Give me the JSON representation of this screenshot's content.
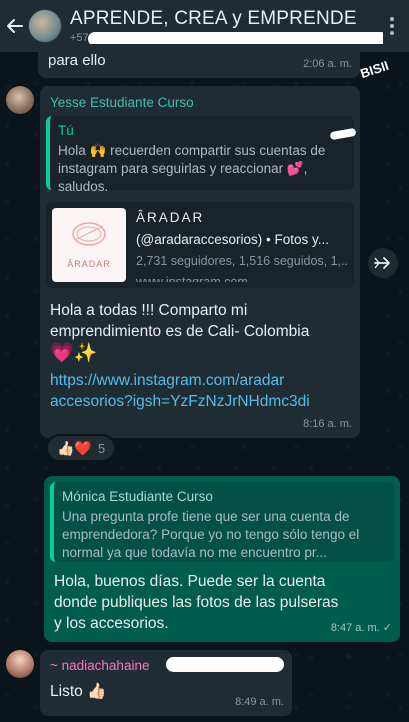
{
  "header": {
    "title": "APRENDE, CREA y EMPRENDE",
    "subtitle": "+57 ... 205...",
    "back_icon": "arrow-left-icon",
    "menu_icon": "vertical-dots-icon"
  },
  "top_message": {
    "text": "para ello",
    "time": "2:06 a. m."
  },
  "message_yesse": {
    "sender": "Yesse Estudiante Curso",
    "quote_author": "Tú",
    "quote_text": "Hola 🙌 recuerden compartir sus cuentas de instagram para seguirlas y reaccionar 💕, saludos.",
    "link_card": {
      "thumb_brand": "ÂRADAR",
      "title": "ÂRADAR",
      "subtitle": "(@aradaraccesorios) • Fotos y...",
      "description": "2,731 seguidores, 1,516 seguidos, 1,... ",
      "domain": "www.instagram.com"
    },
    "body_line1": "Hola a todas !!! Comparto mi",
    "body_line2": "emprendimiento es de Cali- Colombia",
    "body_emoji": "💗✨",
    "url_line1": "https://www.instagram.com/aradar",
    "url_line2": "accesorios?igsh=YzFzNzJrNHdmc3di",
    "time": "8:16 a. m.",
    "reactions": {
      "emojis": "👍🏻❤️",
      "count": "5"
    }
  },
  "message_out": {
    "quote_author": "Mónica Estudiante Curso",
    "quote_text": "Una pregunta profe tiene que ser una cuenta de emprendedora? Porque yo no tengo sólo tengo el normal ya que todavía no me encuentro pr...",
    "body_line1": "Hola, buenos días. Puede ser la cuenta",
    "body_line2": "donde publiques las fotos de las pulseras",
    "body_line3": "y los accesorios.",
    "time": "8:47 a. m. ✓"
  },
  "message_nadia": {
    "sender": "~ nadiachahaine",
    "body": "Listo 👍🏻",
    "time": "8:49 a. m."
  },
  "scribble": "BISII",
  "colors": {
    "header_bg": "#1f2c34",
    "chat_bg": "#0b141a",
    "incoming_bubble": "#202c33",
    "outgoing_bubble": "#005c4b",
    "link": "#53bdeb",
    "sender_green": "#3fc1a9",
    "sender_pink": "#f67ac1"
  }
}
